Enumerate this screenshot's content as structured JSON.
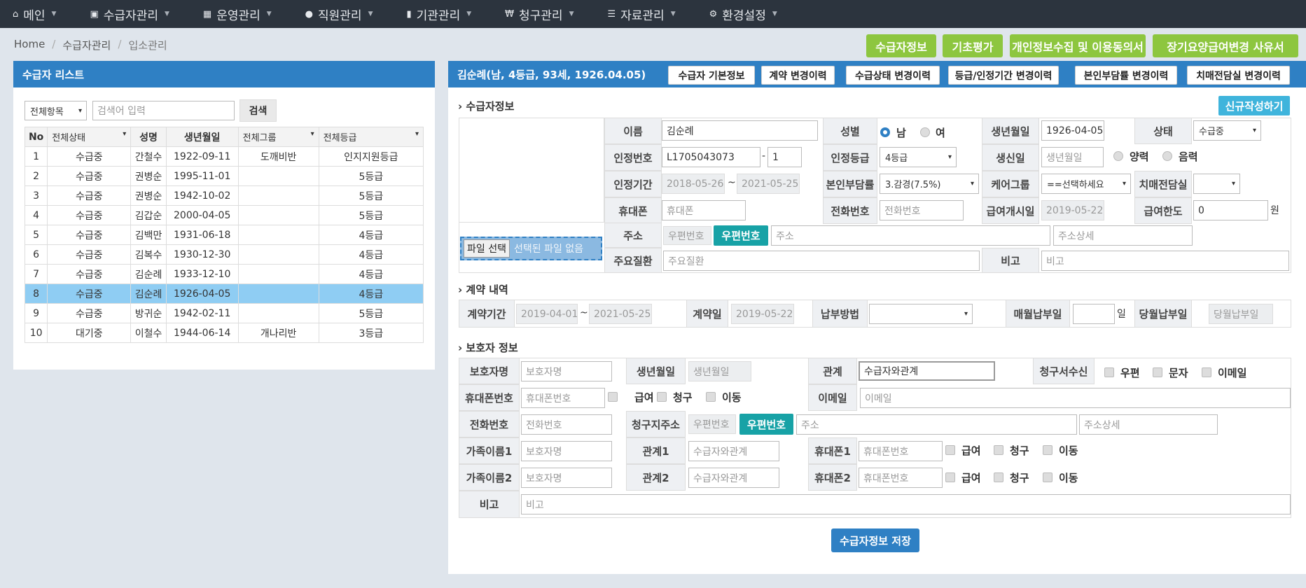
{
  "nav": [
    {
      "icon": "home-icon",
      "glyph": "⌂",
      "label": "메인"
    },
    {
      "icon": "id-card-icon",
      "glyph": "▣",
      "label": "수급자관리"
    },
    {
      "icon": "calendar-icon",
      "glyph": "▦",
      "label": "운영관리"
    },
    {
      "icon": "users-icon",
      "glyph": "●",
      "label": "직원관리"
    },
    {
      "icon": "building-icon",
      "glyph": "▮",
      "label": "기관관리"
    },
    {
      "icon": "won-icon",
      "glyph": "₩",
      "label": "청구관리"
    },
    {
      "icon": "list-icon",
      "glyph": "☰",
      "label": "자료관리"
    },
    {
      "icon": "gear-icon",
      "glyph": "⚙",
      "label": "환경설정"
    }
  ],
  "breadcrumb": {
    "home": "Home",
    "sep": "/",
    "parent": "수급자관리",
    "current": "입소관리"
  },
  "top_buttons": [
    "수급자정보",
    "기초평가",
    "개인정보수집 및 이용동의서",
    "장기요양급여변경 사유서"
  ],
  "left": {
    "title": "수급자 리스트",
    "filter_select": "전체항목",
    "search_placeholder": "검색어 입력",
    "search_button": "검색",
    "headers": {
      "no": "No",
      "status": "전체상태",
      "name": "성명",
      "birth": "생년월일",
      "group": "전체그룹",
      "grade": "전체등급"
    },
    "rows": [
      [
        "1",
        "수급중",
        "간철수",
        "1922-09-11",
        "도깨비반",
        "인지지원등급"
      ],
      [
        "2",
        "수급중",
        "권병순",
        "1995-11-01",
        "",
        "5등급"
      ],
      [
        "3",
        "수급중",
        "권병순",
        "1942-10-02",
        "",
        "5등급"
      ],
      [
        "4",
        "수급중",
        "김갑순",
        "2000-04-05",
        "",
        "5등급"
      ],
      [
        "5",
        "수급중",
        "김백만",
        "1931-06-18",
        "",
        "4등급"
      ],
      [
        "6",
        "수급중",
        "김복수",
        "1930-12-30",
        "",
        "4등급"
      ],
      [
        "7",
        "수급중",
        "김순례",
        "1933-12-10",
        "",
        "4등급"
      ],
      [
        "8",
        "수급중",
        "김순례",
        "1926-04-05",
        "",
        "4등급"
      ],
      [
        "9",
        "수급중",
        "방귀순",
        "1942-02-11",
        "",
        "5등급"
      ],
      [
        "10",
        "대기중",
        "이철수",
        "1944-06-14",
        "개나리반",
        "3등급"
      ]
    ],
    "selected_row": "8"
  },
  "right": {
    "title": "김순례(남, 4등급, 93세, 1926.04.05)",
    "tabs": [
      "수급자 기본정보",
      "계약 변경이력",
      "수급상태 변경이력",
      "등급/인정기간 변경이력",
      "본인부담률 변경이력",
      "치매전담실 변경이력"
    ],
    "sec1": "› 수급자정보",
    "new_button": "신규작성하기",
    "file_button": "파일 선택",
    "file_text": "선택된 파일 없음",
    "labels": {
      "name": "이름",
      "gender": "성별",
      "birth": "생년월일",
      "status": "상태",
      "cert_no": "인정번호",
      "grade": "인정등급",
      "birthday": "생신일",
      "period": "인정기간",
      "copay": "본인부담률",
      "caregroup": "케어그룹",
      "dementia": "치매전담실",
      "mobile": "휴대폰",
      "phone": "전화번호",
      "start": "급여개시일",
      "limit": "급여한도",
      "address": "주소",
      "disease": "주요질환",
      "note": "비고"
    },
    "values": {
      "name": "김순례",
      "male": "남",
      "female": "여",
      "birth": "1926-04-05",
      "status": "수급중",
      "cert_no": "L1705043073",
      "cert_sub": "1",
      "dash": "-",
      "grade": "4등급",
      "birthday_ph": "생년월일",
      "solar": "양력",
      "lunar": "음력",
      "period_from": "2018-05-26",
      "tilde": "~",
      "period_to": "2021-05-25",
      "copay": "3.감경(7.5%)",
      "caregroup": "==선택하세요",
      "dementia": "",
      "mobile_ph": "휴대폰",
      "phone_ph": "전화번호",
      "start": "2019-05-22",
      "limit": "0",
      "won": "원",
      "zip_ph": "우편번호",
      "zip_btn": "우편번호",
      "addr_ph": "주소",
      "addr2_ph": "주소상세",
      "disease_ph": "주요질환",
      "note_ph": "비고"
    },
    "sec2": "› 계약 내역",
    "contract": {
      "period_label": "계약기간",
      "from": "2019-04-01",
      "tilde": "~",
      "to": "2021-05-25",
      "date_label": "계약일",
      "date": "2019-05-22",
      "pay_label": "납부방법",
      "pay": "",
      "monthly_label": "매월납부일",
      "monthly": "",
      "day": "일",
      "current_label": "당월납부일",
      "current_ph": "당월납부일"
    },
    "sec3": "› 보호자 정보",
    "guardian": {
      "name_label": "보호자명",
      "name_ph": "보호자명",
      "birth_label": "생년월일",
      "birth_ph": "생년월일",
      "rel_label": "관계",
      "rel_ph": "수급자와관계",
      "bill_label": "청구서수신",
      "post": "우편",
      "sms": "문자",
      "email_opt": "이메일",
      "mobile_label": "휴대폰번호",
      "mobile_ph": "휴대폰번호",
      "opt1": "급여",
      "opt2": "청구",
      "opt3": "이동",
      "email_label": "이메일",
      "email_ph": "이메일",
      "phone_label": "전화번호",
      "phone_ph": "전화번호",
      "billaddr_label": "청구지주소",
      "zip_ph": "우편번호",
      "zip_btn": "우편번호",
      "addr_ph": "주소",
      "addr2_ph": "주소상세",
      "fam1_label": "가족이름1",
      "fam2_label": "가족이름2",
      "fam_ph": "보호자명",
      "rel1_label": "관계1",
      "rel2_label": "관계2",
      "relx_ph": "수급자와관계",
      "mob1_label": "휴대폰1",
      "mob2_label": "휴대폰2",
      "mobx_ph": "휴대폰번호",
      "note_label": "비고",
      "note_ph": "비고"
    },
    "save_button": "수급자정보 저장"
  }
}
